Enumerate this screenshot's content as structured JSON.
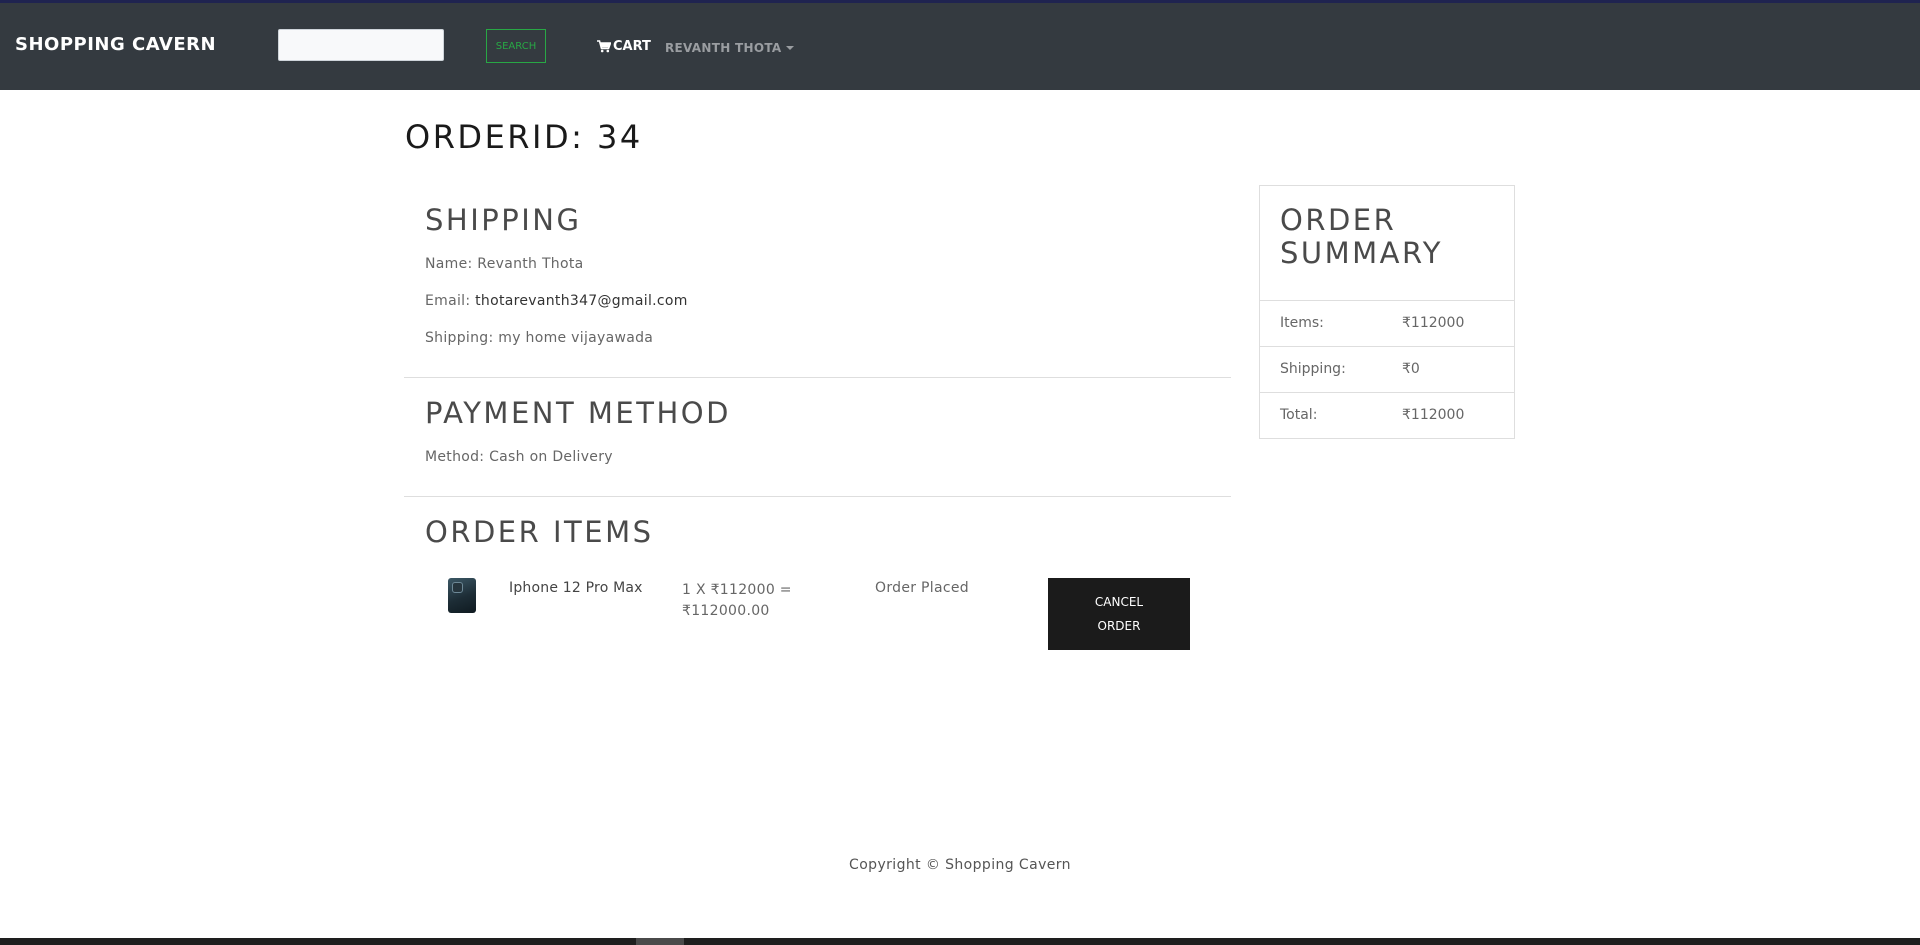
{
  "navbar": {
    "brand": "SHOPPING CAVERN",
    "search_placeholder": "",
    "search_label": "SEARCH",
    "cart_label": "CART",
    "user_label": "REVANTH THOTA"
  },
  "order": {
    "title": "ORDERID: 34"
  },
  "shipping": {
    "heading": "SHIPPING",
    "name_label": "Name:",
    "name": "Revanth Thota",
    "email_label": "Email:",
    "email": "thotarevanth347@gmail.com",
    "address_label": "Shipping:",
    "address": "my home vijayawada"
  },
  "payment": {
    "heading": "PAYMENT METHOD",
    "method_label": "Method:",
    "method": "Cash on Delivery"
  },
  "order_items": {
    "heading": "ORDER ITEMS",
    "items": [
      {
        "name": "Iphone 12 Pro Max",
        "calc": "1 X ₹112000 = ₹112000.00",
        "status": "Order Placed",
        "action_label": "CANCEL ORDER",
        "image_icon": "phone-image"
      }
    ]
  },
  "summary": {
    "heading": "ORDER SUMMARY",
    "rows": [
      {
        "label": "Items:",
        "value": "₹112000"
      },
      {
        "label": "Shipping:",
        "value": "₹0"
      },
      {
        "label": "Total:",
        "value": "₹112000"
      }
    ]
  },
  "footer": {
    "copyright": "Copyright © Shopping Cavern"
  },
  "colors": {
    "navbar_bg": "#343a40",
    "search_accent": "#28a745",
    "cancel_bg": "#1b1b1b"
  }
}
